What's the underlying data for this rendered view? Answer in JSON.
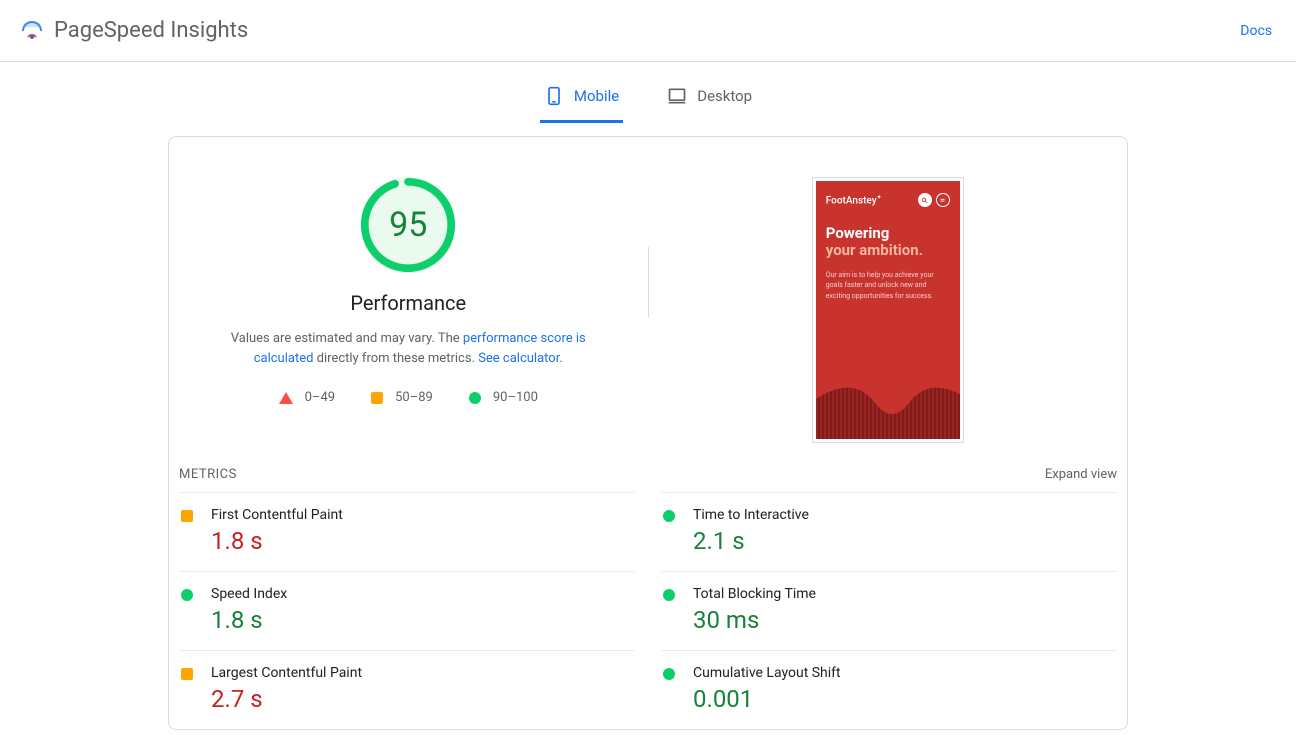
{
  "header": {
    "title": "PageSpeed Insights",
    "docs": "Docs"
  },
  "tabs": {
    "mobile": "Mobile",
    "desktop": "Desktop"
  },
  "gauge": {
    "score": "95",
    "label": "Performance",
    "desc_prefix": "Values are estimated and may vary. The ",
    "desc_link1": "performance score is calculated",
    "desc_mid": " directly from these metrics. ",
    "desc_link2": "See calculator.",
    "arc_pct": 95
  },
  "legend": {
    "fail": "0–49",
    "avg": "50–89",
    "good": "90–100"
  },
  "preview": {
    "brand": "FootAnstey",
    "h1": "Powering",
    "h2": "your ambition.",
    "p": "Our aim is to help you achieve your goals faster and unlock new and exciting opportunities for success."
  },
  "metrics": {
    "title": "METRICS",
    "expand": "Expand view",
    "items": [
      {
        "name": "First Contentful Paint",
        "value": "1.8 s",
        "rating": "avg"
      },
      {
        "name": "Time to Interactive",
        "value": "2.1 s",
        "rating": "good"
      },
      {
        "name": "Speed Index",
        "value": "1.8 s",
        "rating": "good"
      },
      {
        "name": "Total Blocking Time",
        "value": "30 ms",
        "rating": "good"
      },
      {
        "name": "Largest Contentful Paint",
        "value": "2.7 s",
        "rating": "avg"
      },
      {
        "name": "Cumulative Layout Shift",
        "value": "0.001",
        "rating": "good"
      }
    ]
  }
}
